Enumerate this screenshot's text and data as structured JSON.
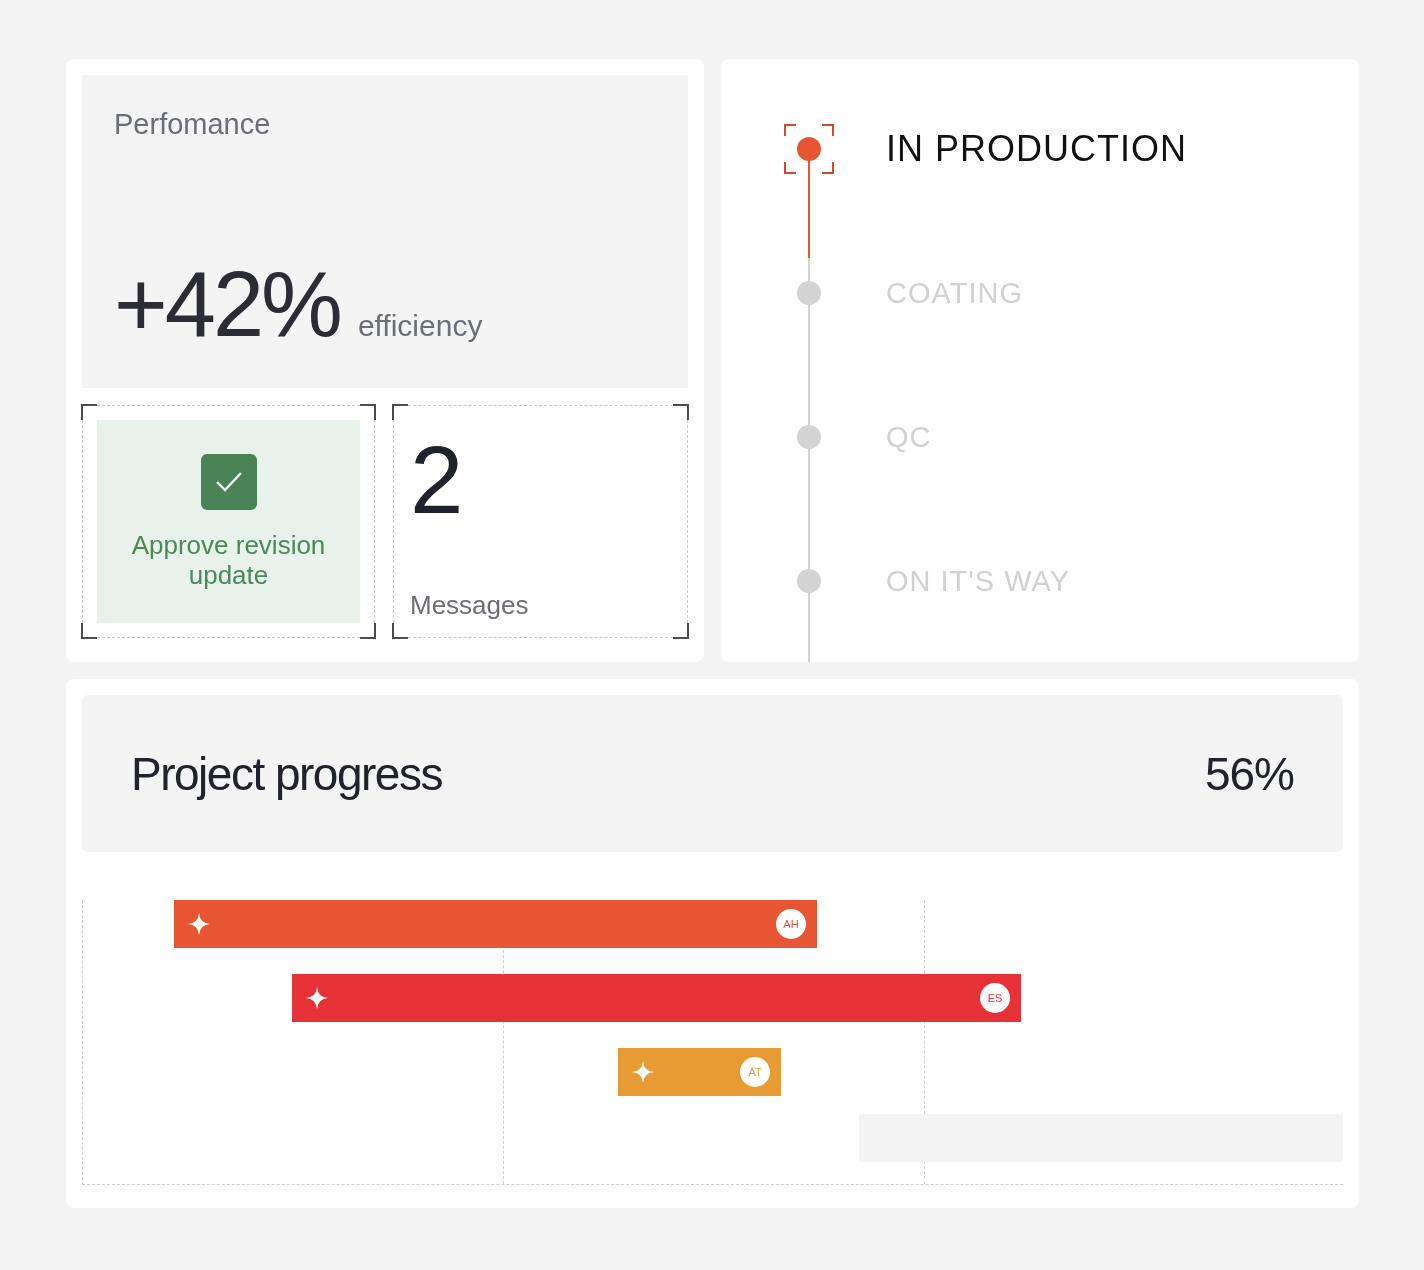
{
  "performance": {
    "label": "Perfomance",
    "value": "+42%",
    "unit": "efficiency"
  },
  "approval": {
    "label": "Approve revision update",
    "checked": true
  },
  "messages": {
    "count": "2",
    "label": "Messages"
  },
  "steps": [
    {
      "label": "IN PRODUCTION",
      "selected": true
    },
    {
      "label": "COATING",
      "selected": false
    },
    {
      "label": "QC",
      "selected": false
    },
    {
      "label": "ON IT'S WAY",
      "selected": false
    }
  ],
  "project": {
    "title": "Project progress",
    "percent": "56%",
    "bars": [
      {
        "kind": "task",
        "initials": "AH",
        "color": "#e85533"
      },
      {
        "kind": "task",
        "initials": "ES",
        "color": "#e63236"
      },
      {
        "kind": "task",
        "initials": "AT",
        "color": "#e79b34"
      },
      {
        "kind": "empty"
      }
    ]
  }
}
